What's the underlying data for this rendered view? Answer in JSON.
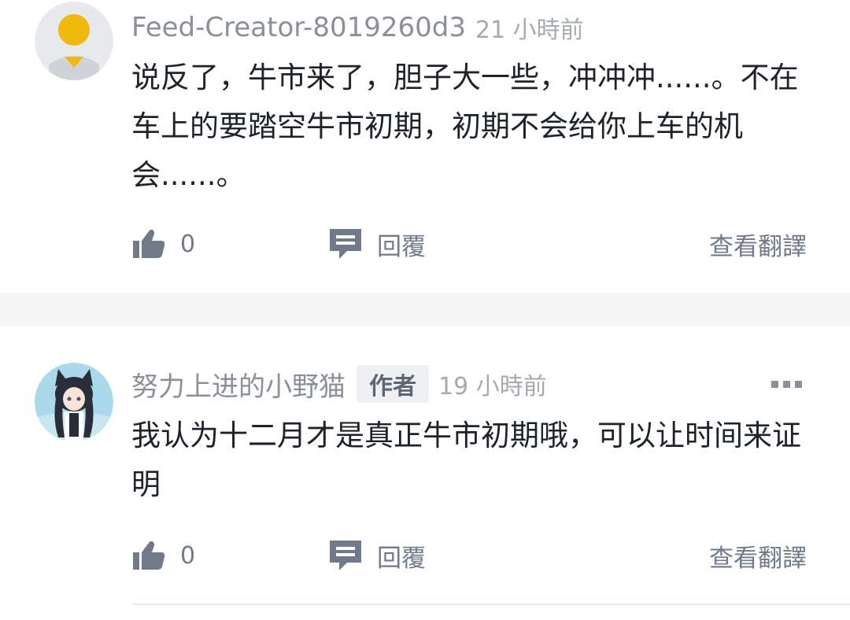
{
  "comments": [
    {
      "username": "Feed-Creator-8019260d3",
      "timestamp": "21 小時前",
      "text": "说反了，牛市来了，胆子大一些，冲冲冲......。不在车上的要踏空牛市初期，初期不会给你上车的机会......。",
      "likes": "0",
      "reply_label": "回覆",
      "translate_label": "查看翻譯",
      "avatar_icon": "default-user-avatar"
    },
    {
      "username": "努力上进的小野猫",
      "badge": "作者",
      "timestamp": "19 小時前",
      "text": "我认为十二月才是真正牛市初期哦，可以让时间来证明",
      "likes": "0",
      "reply_label": "回覆",
      "translate_label": "查看翻譯",
      "avatar_icon": "anime-cat-girl-avatar"
    }
  ],
  "colors": {
    "text_primary": "#1e2329",
    "text_secondary": "#707a8a",
    "divider_band": "#f5f5f5",
    "avatar_yellow": "#f0b90b"
  }
}
